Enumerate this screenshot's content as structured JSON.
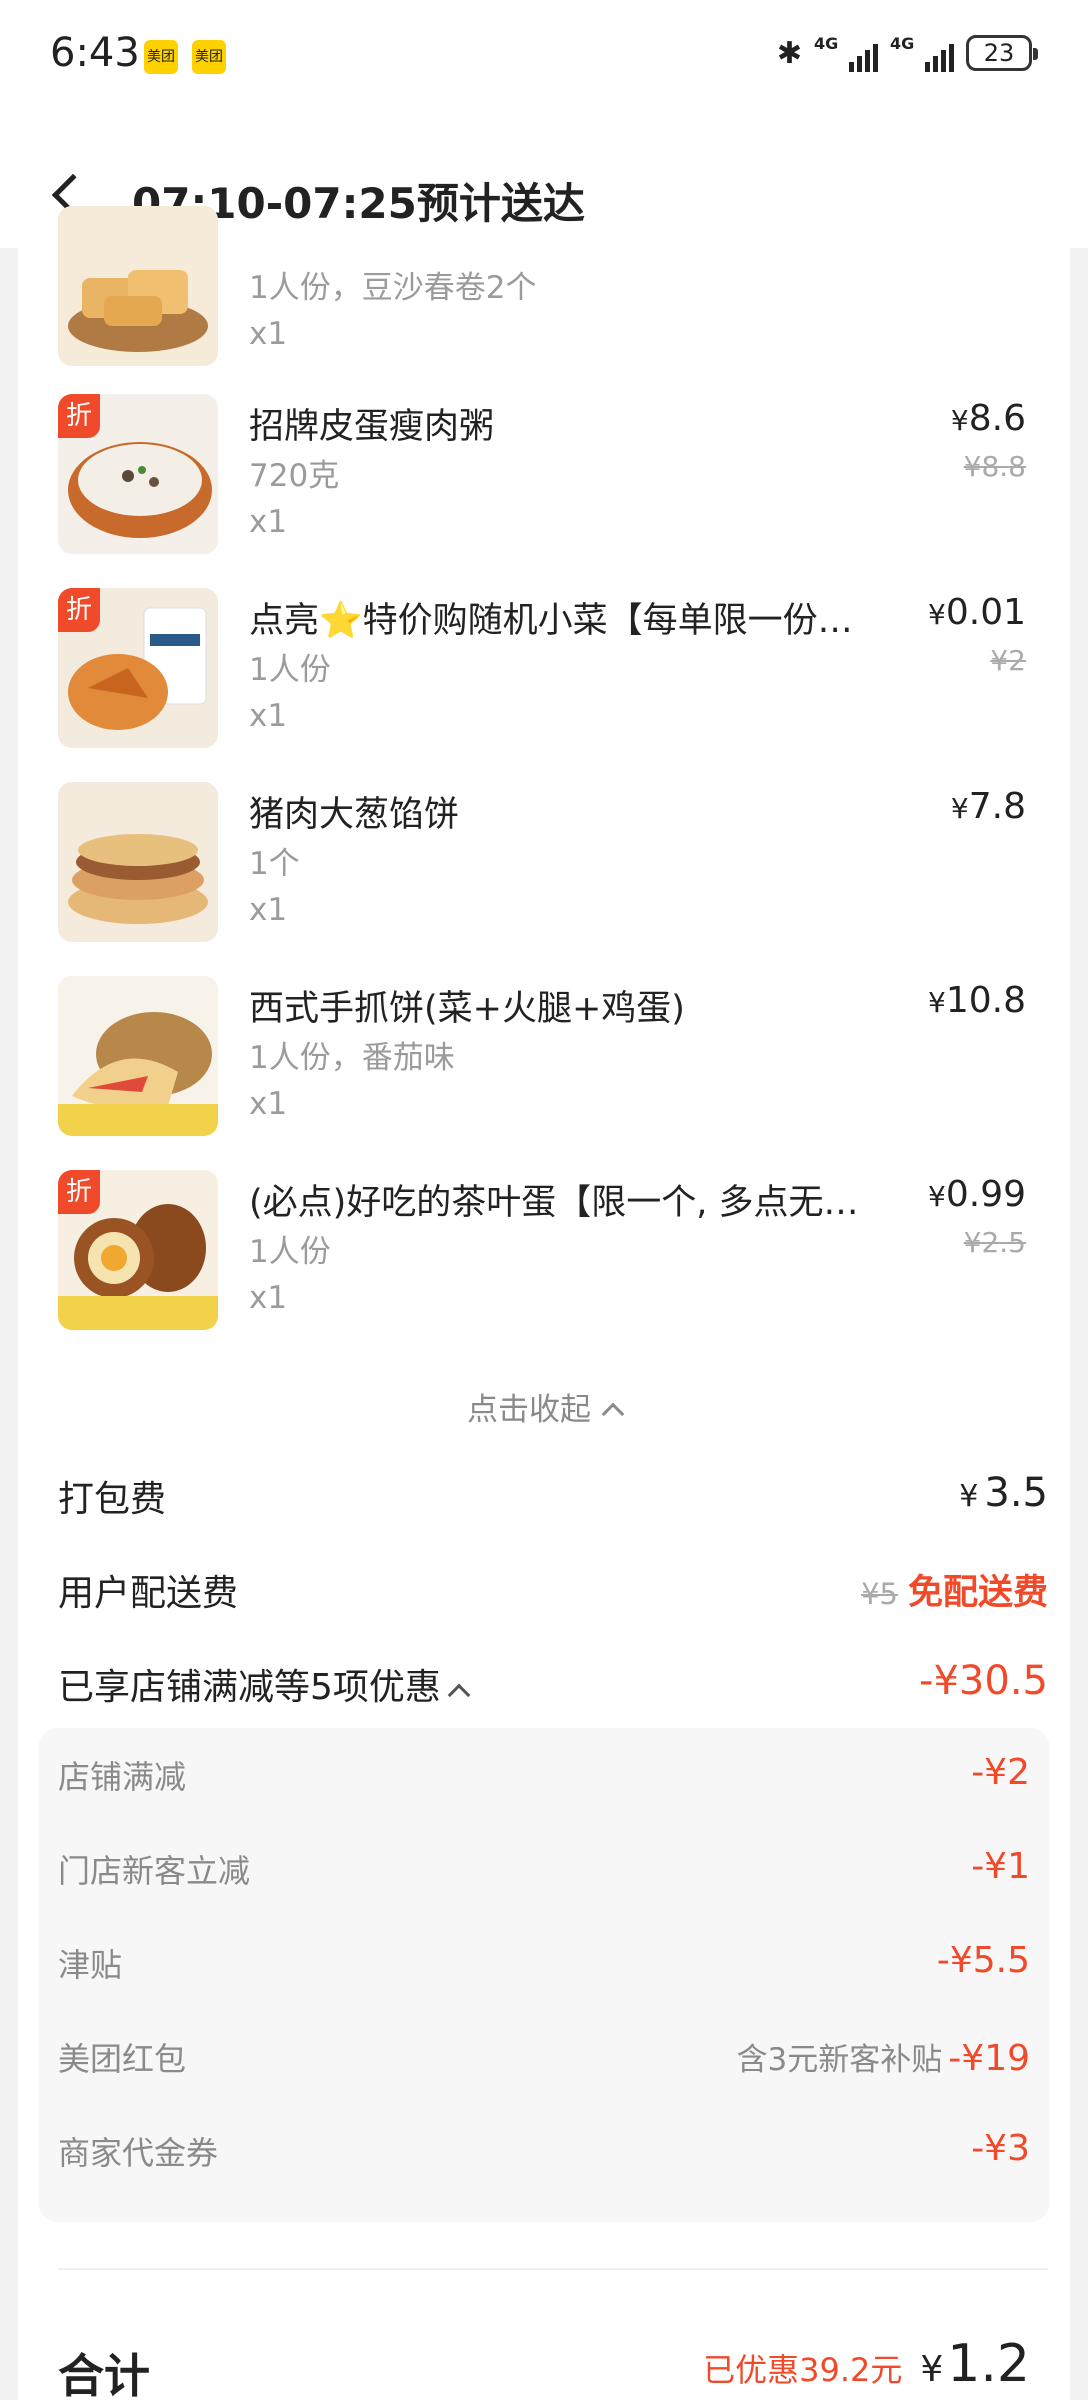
{
  "status_bar": {
    "time": "6:43",
    "app_badges": [
      "美团",
      "美团"
    ],
    "network_1": "4G",
    "network_2": "4G",
    "battery": "23"
  },
  "header": {
    "title": "07:10-07:25预计送达"
  },
  "items": [
    {
      "name": "",
      "spec": "1人份，豆沙春卷2个",
      "qty": "x1",
      "price": "",
      "orig_price": "",
      "discount_tag": "",
      "thumb": "spring-roll"
    },
    {
      "name": "招牌皮蛋瘦肉粥",
      "spec": "720克",
      "qty": "x1",
      "price": "8.6",
      "orig_price": "¥8.8",
      "discount_tag": "折",
      "thumb": "congee"
    },
    {
      "name": "点亮⭐特价购随机小菜【每单限一份…",
      "spec": "1人份",
      "qty": "x1",
      "price": "0.01",
      "orig_price": "¥2",
      "discount_tag": "折",
      "thumb": "side-dish"
    },
    {
      "name": "猪肉大葱馅饼",
      "spec": "1个",
      "qty": "x1",
      "price": "7.8",
      "orig_price": "",
      "discount_tag": "",
      "thumb": "meat-pie"
    },
    {
      "name": "西式手抓饼(菜+火腿+鸡蛋)",
      "spec": "1人份，番茄味",
      "qty": "x1",
      "price": "10.8",
      "orig_price": "",
      "discount_tag": "",
      "thumb": "hand-cake"
    },
    {
      "name": "(必点)好吃的茶叶蛋【限一个, 多点无…",
      "spec": "1人份",
      "qty": "x1",
      "price": "0.99",
      "orig_price": "¥2.5",
      "discount_tag": "折",
      "thumb": "tea-egg"
    }
  ],
  "currency": "¥",
  "collapse_label": "点击收起",
  "packing_fee": {
    "label": "打包费",
    "value": "3.5"
  },
  "delivery_fee": {
    "label": "用户配送费",
    "orig": "¥5",
    "value": "免配送费"
  },
  "discount_summary": {
    "label": "已享店铺满减等5项优惠",
    "value": "-¥30.5"
  },
  "discounts": [
    {
      "label": "店铺满减",
      "note": "",
      "value": "-¥2"
    },
    {
      "label": "门店新客立减",
      "note": "",
      "value": "-¥1"
    },
    {
      "label": "津贴",
      "note": "",
      "value": "-¥5.5"
    },
    {
      "label": "美团红包",
      "note": "含3元新客补贴",
      "value": "-¥19"
    },
    {
      "label": "商家代金券",
      "note": "",
      "value": "-¥3"
    }
  ],
  "total": {
    "label": "合计",
    "saved": "已优惠39.2元",
    "value": "1.2"
  },
  "colors": {
    "accent_red": "#f04a2a",
    "brand_yellow": "#ffd100"
  }
}
